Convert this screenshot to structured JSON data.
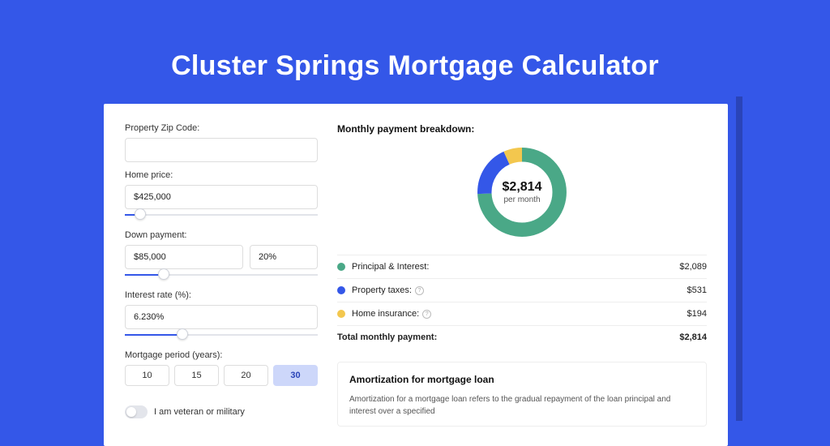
{
  "page": {
    "title": "Cluster Springs Mortgage Calculator"
  },
  "form": {
    "zip_label": "Property Zip Code:",
    "zip_value": "",
    "price_label": "Home price:",
    "price_value": "$425,000",
    "price_slider_percent": 8,
    "down_label": "Down payment:",
    "down_value": "$85,000",
    "down_percent_value": "20%",
    "down_slider_percent": 20,
    "rate_label": "Interest rate (%):",
    "rate_value": "6.230%",
    "rate_slider_percent": 30,
    "period_label": "Mortgage period (years):",
    "periods": [
      "10",
      "15",
      "20",
      "30"
    ],
    "period_selected": "30",
    "veteran_label": "I am veteran or military",
    "veteran_on": false
  },
  "breakdown": {
    "header": "Monthly payment breakdown:",
    "center_amount": "$2,814",
    "center_sub": "per month",
    "items": [
      {
        "label": "Principal & Interest:",
        "value": "$2,089",
        "color": "#4aa887",
        "info": false
      },
      {
        "label": "Property taxes:",
        "value": "$531",
        "color": "#3457e8",
        "info": true
      },
      {
        "label": "Home insurance:",
        "value": "$194",
        "color": "#f3c74e",
        "info": true
      }
    ],
    "total_label": "Total monthly payment:",
    "total_value": "$2,814"
  },
  "chart_data": {
    "type": "pie",
    "title": "Monthly payment breakdown",
    "series": [
      {
        "name": "Principal & Interest",
        "value": 2089,
        "color": "#4aa887"
      },
      {
        "name": "Property taxes",
        "value": 531,
        "color": "#3457e8"
      },
      {
        "name": "Home insurance",
        "value": 194,
        "color": "#f3c74e"
      }
    ],
    "total": 2814,
    "center_label": "$2,814",
    "center_sub": "per month"
  },
  "amortization": {
    "title": "Amortization for mortgage loan",
    "text": "Amortization for a mortgage loan refers to the gradual repayment of the loan principal and interest over a specified"
  }
}
